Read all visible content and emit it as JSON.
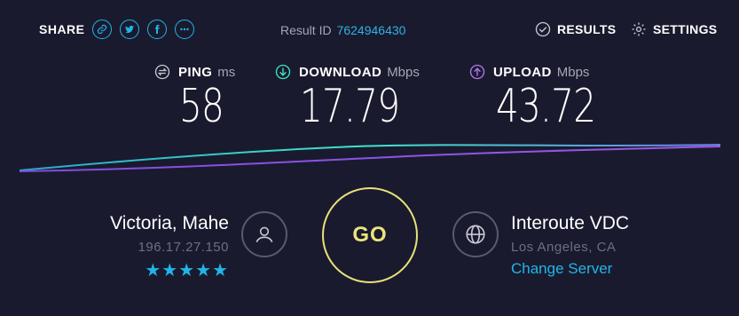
{
  "header": {
    "share_label": "SHARE",
    "social_icons": [
      "link-icon",
      "twitter-icon",
      "facebook-icon",
      "more-icon"
    ],
    "result_id_label": "Result ID",
    "result_id": "7624946430",
    "results_label": "RESULTS",
    "settings_label": "SETTINGS"
  },
  "metrics": {
    "ping": {
      "label": "PING",
      "unit": "ms",
      "value": "58"
    },
    "download": {
      "label": "DOWNLOAD",
      "unit": "Mbps",
      "value": "17.79"
    },
    "upload": {
      "label": "UPLOAD",
      "unit": "Mbps",
      "value": "43.72"
    }
  },
  "isp": {
    "name": "Victoria, Mahe",
    "ip": "196.17.27.150",
    "rating_stars": 5,
    "stars": "★★★★★"
  },
  "go_label": "GO",
  "server": {
    "name": "Interoute VDC",
    "location": "Los Angeles, CA",
    "change_label": "Change Server"
  },
  "colors": {
    "background": "#1a1a2e",
    "accent_blue": "#1fb6e8",
    "go_yellow": "#e8e27a",
    "download_line": "#3fe6c8",
    "upload_line": "#9b59e6"
  }
}
